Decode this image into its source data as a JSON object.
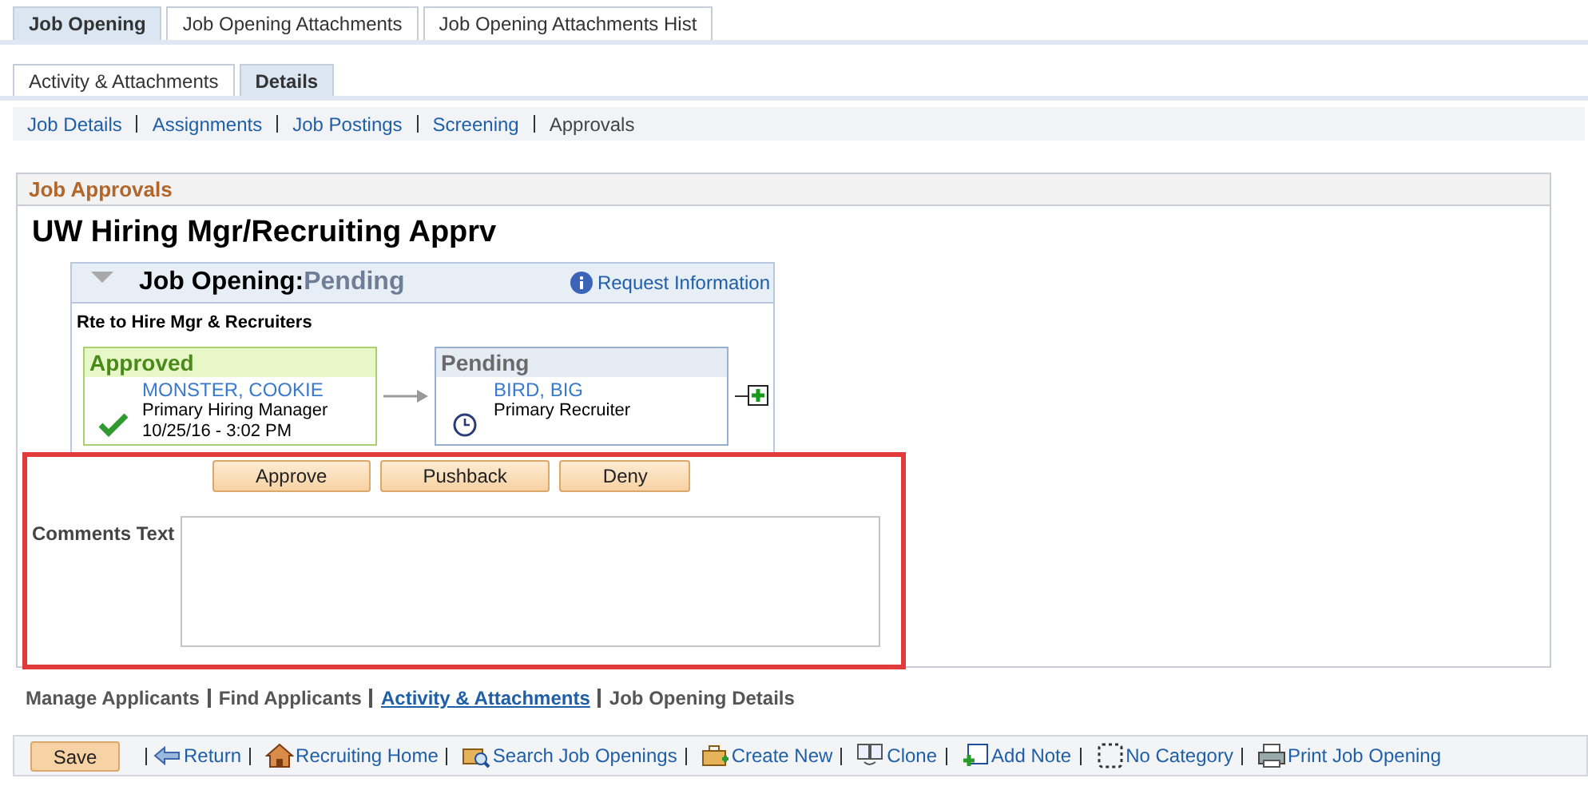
{
  "tabs": [
    {
      "label": "Job Opening",
      "selected": true
    },
    {
      "label": "Job Opening Attachments",
      "selected": false
    },
    {
      "label": "Job Opening Attachments Hist",
      "selected": false
    }
  ],
  "subtabs": [
    {
      "label": "Activity & Attachments",
      "selected": false
    },
    {
      "label": "Details",
      "selected": true
    }
  ],
  "section_links": [
    {
      "label": "Job Details",
      "selected": false
    },
    {
      "label": "Assignments",
      "selected": false
    },
    {
      "label": "Job Postings",
      "selected": false
    },
    {
      "label": "Screening",
      "selected": false
    },
    {
      "label": "Approvals",
      "selected": true
    }
  ],
  "panel": {
    "header": "Job Approvals",
    "title": "UW Hiring Mgr/Recruiting Apprv",
    "workflow": {
      "label": "Job Opening:",
      "status": "Pending",
      "expanded": true,
      "request_link": "Request Information",
      "route": "Rte to Hire Mgr & Recruiters",
      "steps": [
        {
          "kind": "approved",
          "status": "Approved",
          "name": "MONSTER, COOKIE",
          "role": "Primary Hiring Manager",
          "date": "10/25/16 - 3:02 PM"
        },
        {
          "kind": "pending",
          "status": "Pending",
          "name": "BIRD, BIG",
          "role": "Primary Recruiter"
        }
      ]
    },
    "actions": [
      "Approve",
      "Pushback",
      "Deny"
    ],
    "comments": {
      "label": "Comments Text"
    }
  },
  "bottom_links": [
    {
      "label": "Manage Applicants",
      "selected": false
    },
    {
      "label": "Find Applicants",
      "selected": false
    },
    {
      "label": "Activity & Attachments",
      "selected": true
    },
    {
      "label": "Job Opening Details",
      "selected": false
    }
  ],
  "toolbar": {
    "save": "Save",
    "items": [
      {
        "kind": "return",
        "label": "Return"
      },
      {
        "kind": "home",
        "label": "Recruiting Home"
      },
      {
        "kind": "search",
        "label": "Search Job Openings"
      },
      {
        "kind": "create",
        "label": "Create New"
      },
      {
        "kind": "clone",
        "label": "Clone"
      },
      {
        "kind": "note",
        "label": "Add Note"
      },
      {
        "kind": "category",
        "label": "No Category"
      },
      {
        "kind": "print",
        "label": "Print Job Opening"
      }
    ]
  }
}
